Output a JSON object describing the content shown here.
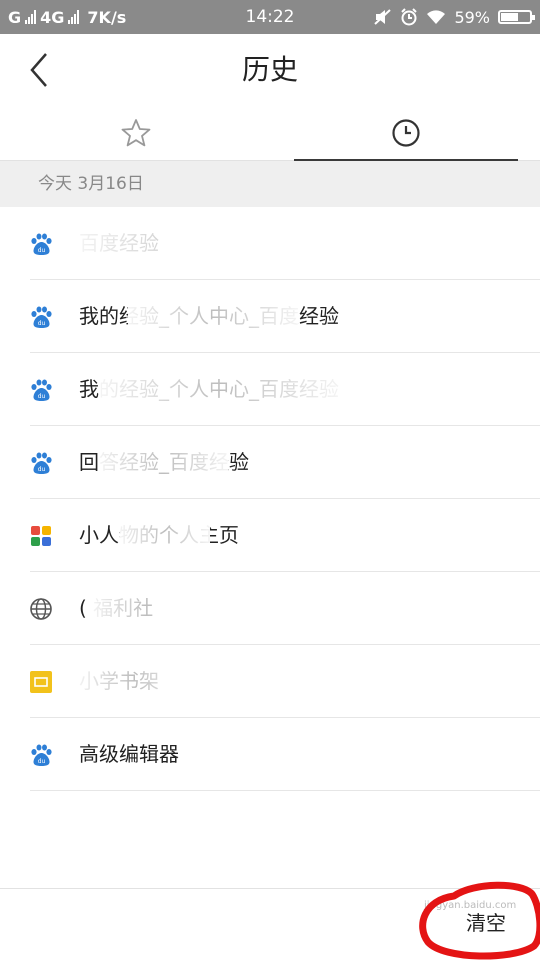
{
  "status_bar": {
    "carrier": "G",
    "network": "4G",
    "speed": "7K/s",
    "time": "14:22",
    "battery_percent": "59%",
    "battery_level": 0.59,
    "icons": [
      "signal-icon",
      "mute-icon",
      "alarm-icon",
      "wifi-icon",
      "battery-icon"
    ]
  },
  "header": {
    "title": "历史",
    "back_icon": "chevron-left-icon"
  },
  "tabs": [
    {
      "name": "favorites",
      "icon": "star-icon",
      "active": false
    },
    {
      "name": "history",
      "icon": "clock-icon",
      "active": true
    }
  ],
  "section": {
    "label": "今天  3月16日"
  },
  "history_items": [
    {
      "icon": "baidu-paw-icon",
      "title": "百度经验"
    },
    {
      "icon": "baidu-paw-icon",
      "title": "我的经验_个人中心_百度经验"
    },
    {
      "icon": "baidu-paw-icon",
      "title": "我的经验_个人中心_百度经验"
    },
    {
      "icon": "baidu-paw-icon",
      "title": "回答经验_百度经验"
    },
    {
      "icon": "colorful-app-icon",
      "title": "小人物的个人主页"
    },
    {
      "icon": "globe-icon",
      "title": "( 福利社"
    },
    {
      "icon": "yellow-app-icon",
      "title": "小学书架"
    },
    {
      "icon": "baidu-paw-icon",
      "title": "高级编辑器"
    }
  ],
  "bottom_bar": {
    "clear_label": "清空"
  },
  "watermark": {
    "text": "jingyan.baidu.com"
  },
  "colors": {
    "status_bar_bg": "#8a8a8a",
    "section_bg": "#efefef",
    "baidu_blue": "#2e7fd6",
    "highlight_red": "#e41414"
  }
}
